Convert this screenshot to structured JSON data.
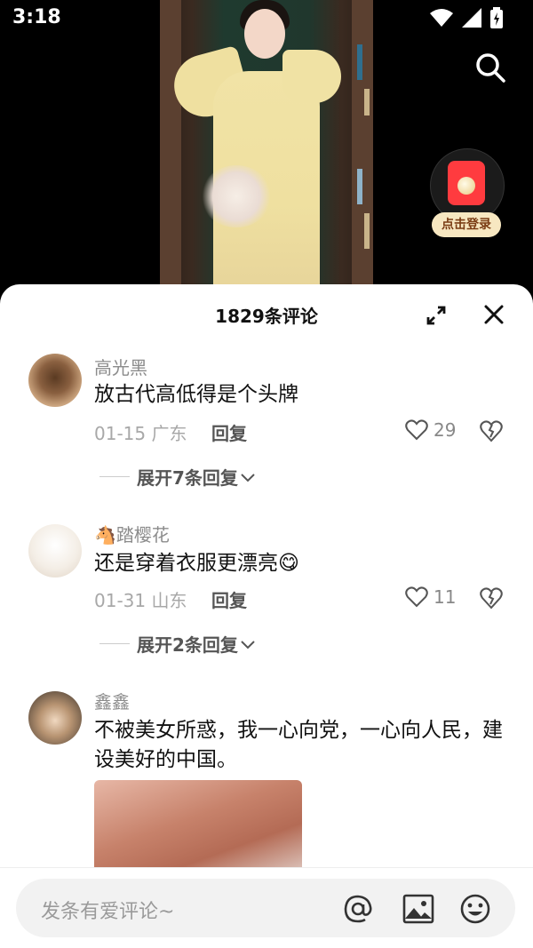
{
  "status_bar": {
    "time": "3:18"
  },
  "login_badge": {
    "label": "点击登录"
  },
  "comments_panel": {
    "title": "1829条评论",
    "comments": [
      {
        "user": "高光黑",
        "text": "放古代高低得是个头牌",
        "meta": "01-15 广东",
        "reply_label": "回复",
        "likes": "29",
        "expand_label": "展开7条回复"
      },
      {
        "user": "🐴踏樱花",
        "text": "还是穿着衣服更漂亮😋",
        "meta": "01-31 山东",
        "reply_label": "回复",
        "likes": "11",
        "expand_label": "展开2条回复"
      },
      {
        "user": "鑫鑫",
        "text": "不被美女所惑，我一心向党，一心向人民，建设美好的中国。"
      }
    ]
  },
  "input_bar": {
    "placeholder": "发条有爱评论~"
  }
}
